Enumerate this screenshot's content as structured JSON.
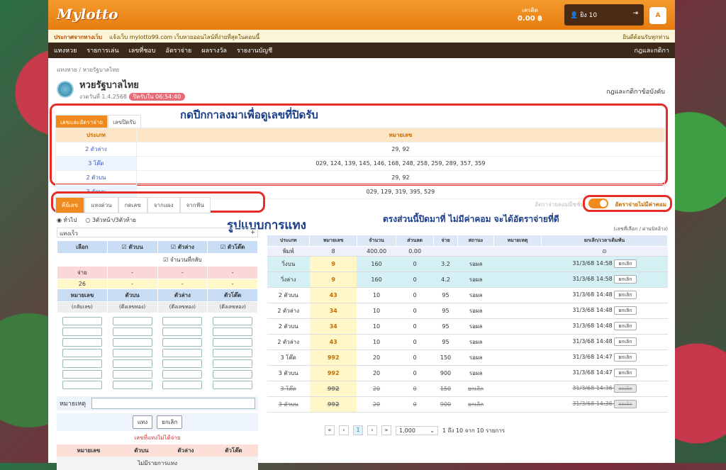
{
  "header": {
    "logo": "Mylotto",
    "credit_label": "เครดิต",
    "credit_value": "0.00 ฿",
    "username": "ยิง 10",
    "marquee_label": "ประกาศจากทางเว็บ",
    "marquee_text": "แจ้งเว็บ mylotto99.com เว็บหวยออนไลน์ที่ง่ายที่สุดในตอนนี้",
    "marquee_right": "ยินดีต้อนรับทุกท่าน"
  },
  "nav": [
    "แทงหวย",
    "รายการเล่น",
    "เลขที่ชอบ",
    "อัตราจ่าย",
    "ผลรางวัล",
    "รายงานบัญชี"
  ],
  "nav_right": "กฎและกติกา",
  "breadcrumb": "แทงหวย / หวยรัฐบาลไทย",
  "lottery": {
    "name": "หวยรัฐบาลไทย",
    "round": "งวดวันที่ 1.4.2568",
    "countdown": "ปิดรับใน 06:54:40"
  },
  "rules_link": "กฎและกติกาข้อบังคับ",
  "annotations": {
    "top": "กดปีกกาลงมาเพื่อดูเลขที่ปิดรับ",
    "middle": "รูปแบบการแทง",
    "right": "ตรงส่วนนี้ปิดมาที่ ไม่มีค่าคอม จะได้อัตราจ่ายที่ดี"
  },
  "top_tabs": [
    "เลขและอัตราจ่าย",
    "เลขปิดรับ"
  ],
  "closed_table": {
    "headers": [
      "ประเภท",
      "หมายเลข"
    ],
    "rows": [
      [
        "2 ตัวล่าง",
        "29, 92"
      ],
      [
        "3 โต๊ด",
        "029, 124, 139, 145, 146, 168, 248, 258, 259, 289, 357, 359"
      ],
      [
        "2 ตัวบน",
        "29, 92"
      ],
      [
        "3 ตัวบน",
        "029, 129, 319, 395, 529"
      ]
    ]
  },
  "bet_tabs": [
    "คีย์เลข",
    "แทงด่วน",
    "กดเลข",
    "จากแผง",
    "จากฟัน"
  ],
  "toggle": {
    "left": "อัตราจ่ายคอมมิชชั่น",
    "right": "อัตราจ่ายไม่มีค่าคอม"
  },
  "left": {
    "radios": [
      "ทั่วไป",
      "3ตัวหน้า/3ตัวท้าย"
    ],
    "quick": "แทงเร็ว",
    "select_headers": [
      "เลือก",
      "ตัวบน",
      "ตัวล่าง",
      "ตัวโต๊ด"
    ],
    "reverse": "จำนวนที่กลับ",
    "pay_label": "จ่าย",
    "pay_value": "26",
    "col_headers": [
      "หมายเลข",
      "ตัวบน",
      "ตัวล่าง",
      "ตัวโต๊ด"
    ],
    "col_subs": [
      "(กลับเลข)",
      "(ดึงเลขทอง)",
      "(ดึงเลขทอง)",
      "(ดึงเลขทอง)"
    ],
    "note_label": "หมายเหตุ",
    "btn_bet": "แทง",
    "btn_cancel": "ยกเลิก",
    "closed_title": "เลขที่แทงไม่ได้จ่าย",
    "closed_headers": [
      "หมายเลข",
      "ตัวบน",
      "ตัวล่าง",
      "ตัวโต๊ด"
    ],
    "closed_empty": "ไม่มีรายการแทง"
  },
  "right": {
    "head": "(เลขที่เลือก / ผ่านบิลอ้าง)",
    "headers": [
      "ประเภท",
      "หมายเลข",
      "จำนวน",
      "ส่วนลด",
      "จ่าย",
      "สถานะ",
      "หมายเหตุ",
      "ยกเลิก/เวลาเดิมพัน"
    ],
    "input_row": [
      "พิมพ์",
      "8",
      "400.00",
      "0.00"
    ],
    "rows": [
      [
        "วิ่งบน",
        "9",
        "160",
        "0",
        "3.2",
        "รอผล",
        "",
        "31/3/68 14:58",
        "ยกเลิก"
      ],
      [
        "วิ่งล่าง",
        "9",
        "160",
        "0",
        "4.2",
        "รอผล",
        "",
        "31/3/68 14:58",
        "ยกเลิก"
      ],
      [
        "2 ตัวบน",
        "43",
        "10",
        "0",
        "95",
        "รอผล",
        "",
        "31/3/68 14:48",
        "ยกเลิก"
      ],
      [
        "2 ตัวล่าง",
        "34",
        "10",
        "0",
        "95",
        "รอผล",
        "",
        "31/3/68 14:48",
        "ยกเลิก"
      ],
      [
        "2 ตัวบน",
        "34",
        "10",
        "0",
        "95",
        "รอผล",
        "",
        "31/3/68 14:48",
        "ยกเลิก"
      ],
      [
        "2 ตัวล่าง",
        "43",
        "10",
        "0",
        "95",
        "รอผล",
        "",
        "31/3/68 14:48",
        "ยกเลิก"
      ],
      [
        "3 โต๊ด",
        "992",
        "20",
        "0",
        "150",
        "รอผล",
        "",
        "31/3/68 14:47",
        "ยกเลิก"
      ],
      [
        "3 ตัวบน",
        "992",
        "20",
        "0",
        "900",
        "รอผล",
        "",
        "31/3/68 14:47",
        "ยกเลิก"
      ],
      [
        "3 โต๊ด",
        "992",
        "20",
        "0",
        "150",
        "ยกเลิก",
        "",
        "31/3/68 14:36",
        "ยกเลิก"
      ],
      [
        "3 ตัวบน",
        "992",
        "20",
        "0",
        "900",
        "ยกเลิก",
        "",
        "31/3/68 14:36",
        "ยกเลิก"
      ]
    ],
    "pager_page": "1",
    "page_size": "1,000",
    "summary": "1 ถึง 10 จาก 10 รายการ"
  }
}
